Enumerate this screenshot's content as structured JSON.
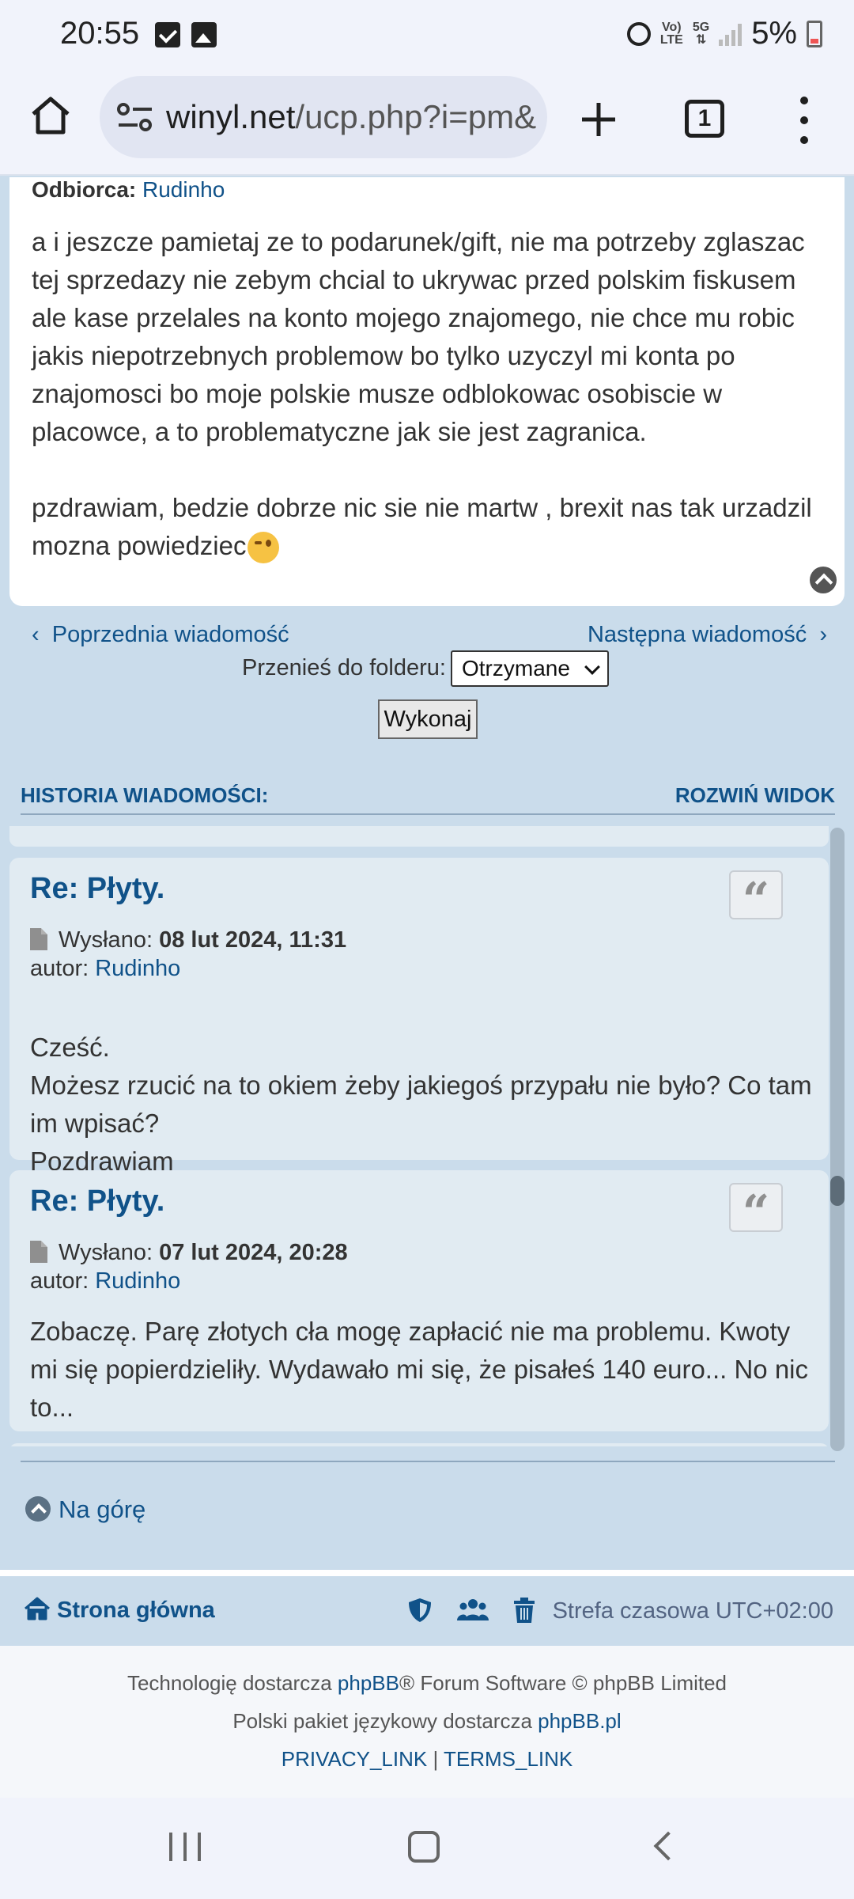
{
  "status_bar": {
    "time": "20:55",
    "network_top": "Vo)",
    "network_bottom": "LTE",
    "gen_top": "5G",
    "gen_bottom": "⇅",
    "battery": "5%"
  },
  "browser": {
    "url_host": "winyl.net",
    "url_path": "/ucp.php?i=pm&",
    "tab_count": "1"
  },
  "message": {
    "recipient_label": "Odbiorca:",
    "recipient_name": "Rudinho",
    "paragraph1": "a i jeszcze pamietaj ze to podarunek/gift, nie ma potrzeby zglaszac tej sprzedazy nie zebym chcial to ukrywac przed polskim fiskusem ale kase przelales na konto mojego znajomego, nie chce mu robic jakis niepotrzebnych problemow bo tylko uzyczyl mi konta po znajomosci bo moje polskie musze odblokowac osobiscie w placowce, a to problematyczne jak sie jest zagranica.",
    "paragraph2": "pzdrawiam, bedzie dobrze nic sie nie martw , brexit nas tak urzadzil mozna powiedziec"
  },
  "nav": {
    "prev_label": "Poprzednia wiadomość",
    "next_label": "Następna wiadomość",
    "folder_label": "Przenieś do folderu:",
    "folder_selected": "Otrzymane",
    "execute_label": "Wykonaj"
  },
  "history": {
    "heading": "HISTORIA WIADOMOŚCI:",
    "expand_label": "ROZWIŃ WIDOK",
    "posts": [
      {
        "title": "Re: Płyty.",
        "sent_label": "Wysłano:",
        "date": "08 lut 2024, 11:31",
        "author_label": "autor:",
        "author": "Rudinho",
        "lines": [
          "Cześć.",
          "Możesz rzucić na to okiem żeby jakiegoś przypału nie było? Co tam im wpisać?",
          "Pozdrawiam"
        ]
      },
      {
        "title": "Re: Płyty.",
        "sent_label": "Wysłano:",
        "date": "07 lut 2024, 20:28",
        "author_label": "autor:",
        "author": "Rudinho",
        "lines": [
          "Zobaczę. Parę złotych cła mogę zapłacić nie ma problemu. Kwoty mi się popierdzieliły. Wydawało mi się, że pisałeś 140 euro... No nic to..."
        ]
      }
    ]
  },
  "back_to_top": "Na górę",
  "footer": {
    "home_label": "Strona główna",
    "timezone": "Strefa czasowa UTC+02:00",
    "credit1_pre": "Technologię dostarcza ",
    "credit1_link": "phpBB",
    "credit1_post": "® Forum Software © phpBB Limited",
    "credit2_pre": "Polski pakiet językowy dostarcza ",
    "credit2_link": "phpBB.pl",
    "privacy": "PRIVACY_LINK",
    "divider": "|",
    "terms": "TERMS_LINK"
  },
  "icons": {
    "quote": "quote-icon",
    "home": "home-icon",
    "shield": "shield-icon",
    "users": "users-icon",
    "trash": "trash-icon"
  },
  "colors": {
    "link": "#105289",
    "page_bg": "#cadceb",
    "post_bg": "#e1ebf2"
  }
}
